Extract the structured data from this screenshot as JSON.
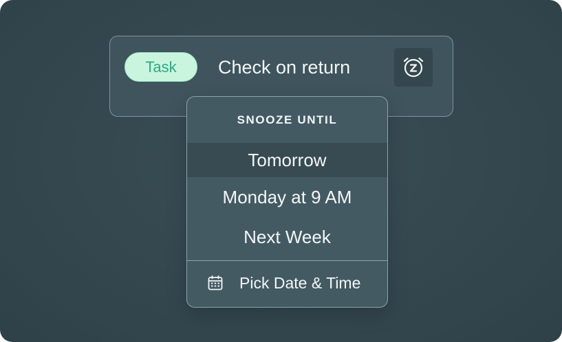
{
  "task": {
    "chip_label": "Task",
    "title": "Check on return",
    "snooze_icon": "alarm-snooze-icon"
  },
  "snooze_menu": {
    "header": "SNOOZE UNTIL",
    "options": [
      {
        "label": "Tomorrow",
        "selected": true
      },
      {
        "label": "Monday at 9 AM",
        "selected": false
      },
      {
        "label": "Next Week",
        "selected": false
      }
    ],
    "pick_date": {
      "label": "Pick Date & Time",
      "icon": "calendar-icon"
    }
  },
  "colors": {
    "background": "#34474f",
    "card": "#3f545c",
    "menu": "#445a63",
    "menu_highlight": "#384b53",
    "chip_bg": "#c9f5df",
    "chip_text": "#2fa880",
    "text": "#f3f6f7"
  }
}
